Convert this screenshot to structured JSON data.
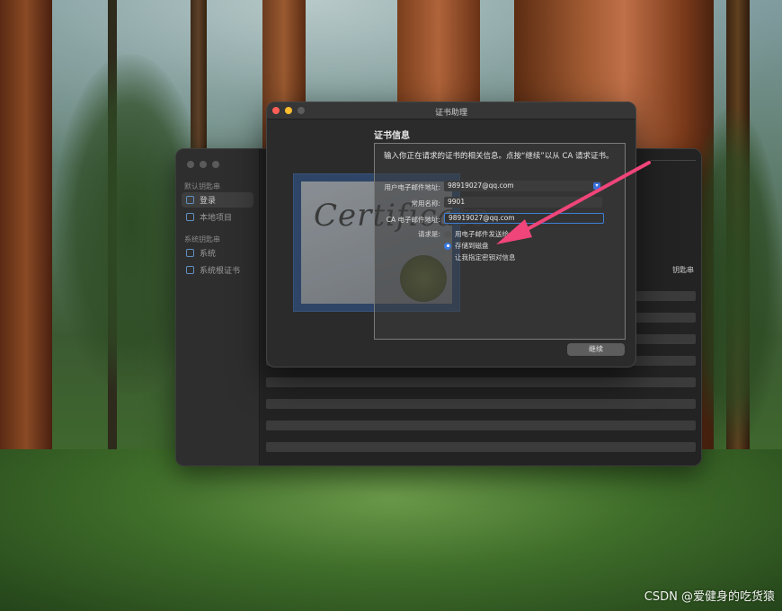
{
  "keychain_window": {
    "sidebar": {
      "default_group": "默认钥匙串",
      "default_items": [
        "登录",
        "本地项目"
      ],
      "system_group": "系统钥匙串",
      "system_items": [
        "系统",
        "系统根证书"
      ]
    },
    "column_header": "钥匙串"
  },
  "assistant_window": {
    "title": "证书助理",
    "section_title": "证书信息",
    "instruction": "输入你正在请求的证书的相关信息。点按“继续”以从 CA 请求证书。",
    "fields": {
      "user_email_label": "用户电子邮件地址:",
      "user_email_value": "98919027@qq.com",
      "common_name_label": "常用名称:",
      "common_name_value": "9901",
      "ca_email_label": "CA 电子邮件地址:",
      "ca_email_value": "98919027@qq.com"
    },
    "request_label": "请求是:",
    "request_options": [
      {
        "label": "用电子邮件发送给",
        "selected": false
      },
      {
        "label": "存储到磁盘",
        "selected": true
      }
    ],
    "checkbox_label": "让我指定密钥对信息",
    "checkbox_checked": false,
    "continue_label": "继续",
    "illustration_text": "Certificate"
  },
  "colors": {
    "accent_blue": "#3a78e0",
    "annotation_pink": "#f0457a",
    "close": "#ff5f57",
    "minimize": "#febc2e"
  },
  "icons": [
    "person-icon",
    "folder-icon",
    "lock-icon",
    "badge-icon",
    "chevron-down-icon"
  ],
  "watermark": "CSDN @爱健身的吃货猿"
}
